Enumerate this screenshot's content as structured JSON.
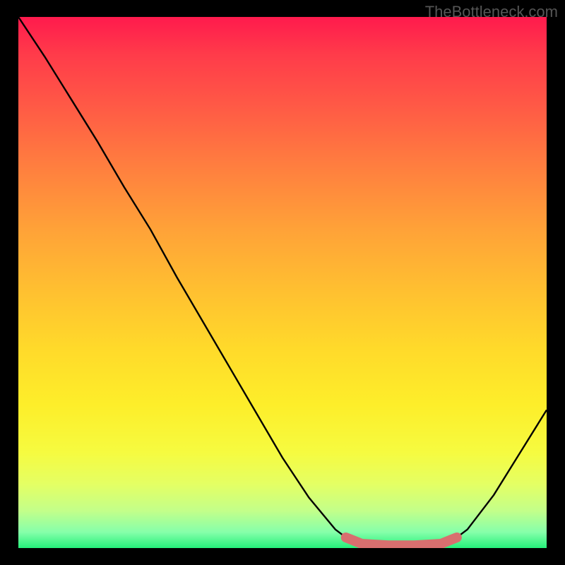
{
  "watermark": "TheBottleneck.com",
  "chart_data": {
    "type": "line",
    "title": "",
    "xlabel": "",
    "ylabel": "",
    "x_range": [
      0,
      100
    ],
    "y_range": [
      0,
      100
    ],
    "series": [
      {
        "name": "curve",
        "x": [
          0,
          5,
          10,
          15,
          20,
          25,
          30,
          35,
          40,
          45,
          50,
          55,
          60,
          62,
          65,
          70,
          75,
          80,
          83,
          85,
          90,
          95,
          100
        ],
        "y": [
          100,
          92.5,
          84.5,
          76.5,
          68,
          60,
          51,
          42.5,
          34,
          25.5,
          17,
          9.5,
          3.5,
          2,
          0.8,
          0.5,
          0.5,
          0.8,
          2,
          3.5,
          10,
          18,
          26
        ]
      }
    ],
    "highlight": {
      "x": [
        62,
        65,
        70,
        75,
        80,
        83
      ],
      "y": [
        2,
        0.8,
        0.5,
        0.5,
        0.8,
        2
      ]
    },
    "colors": {
      "gradient_top": "#ff1a4d",
      "gradient_bottom": "#25f07a",
      "curve": "#000000",
      "highlight": "#d86f6f",
      "background": "#000000"
    }
  }
}
